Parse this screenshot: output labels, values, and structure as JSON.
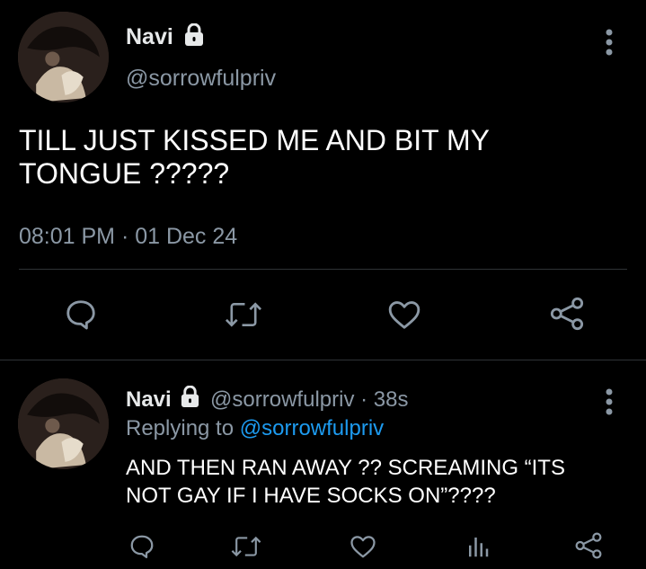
{
  "main_tweet": {
    "display_name": "Navi",
    "handle": "@sorrowfulpriv",
    "text_line1": "TILL JUST KISSED ME AND BIT MY",
    "text_line2": "TONGUE ?????",
    "timestamp": "08:01 PM · 01 Dec 24"
  },
  "reply_tweet": {
    "display_name": "Navi",
    "handle_time": "@sorrowfulpriv · 38s",
    "replying_prefix": "Replying to ",
    "replying_handle": "@sorrowfulpriv",
    "text_line1": "AND THEN RAN AWAY ?? SCREAMING “ITS",
    "text_line2": "NOT GAY IF I HAVE SOCKS ON”????"
  },
  "icons": [
    "lock-icon",
    "more-icon",
    "reply-icon",
    "retweet-icon",
    "like-icon",
    "share-icon",
    "analytics-icon"
  ],
  "colors": {
    "background": "#000000",
    "text": "#e7e9ea",
    "muted": "#8b98a5",
    "link": "#1d9bf0",
    "divider": "#2f3336"
  }
}
